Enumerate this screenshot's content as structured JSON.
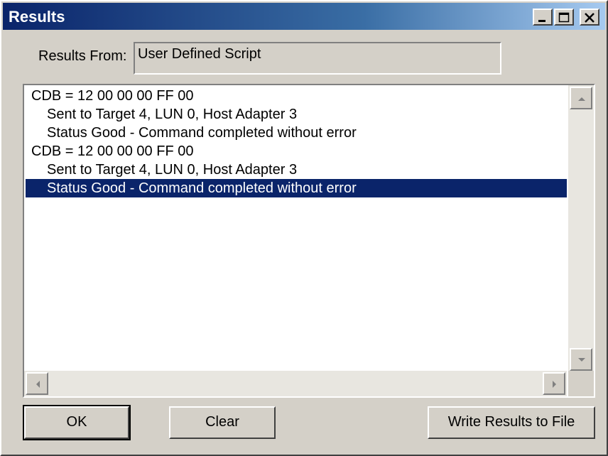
{
  "window": {
    "title": "Results"
  },
  "results_from": {
    "label": "Results From:",
    "value": "User Defined Script"
  },
  "results_list": [
    {
      "text": "CDB = 12 00 00 00 FF 00",
      "indent": false,
      "selected": false
    },
    {
      "text": "Sent to Target 4, LUN 0, Host Adapter 3",
      "indent": true,
      "selected": false
    },
    {
      "text": "Status Good - Command completed without error",
      "indent": true,
      "selected": false
    },
    {
      "text": "CDB = 12 00 00 00 FF 00",
      "indent": false,
      "selected": false
    },
    {
      "text": "Sent to Target 4, LUN 0, Host Adapter 3",
      "indent": true,
      "selected": false
    },
    {
      "text": "Status Good - Command completed without error",
      "indent": true,
      "selected": true
    }
  ],
  "buttons": {
    "ok": "OK",
    "clear": "Clear",
    "write": "Write Results to File"
  },
  "colors": {
    "titlebar_start": "#0a246a",
    "titlebar_end": "#a6caf0",
    "selection": "#0a246a",
    "face": "#d4d0c8"
  }
}
